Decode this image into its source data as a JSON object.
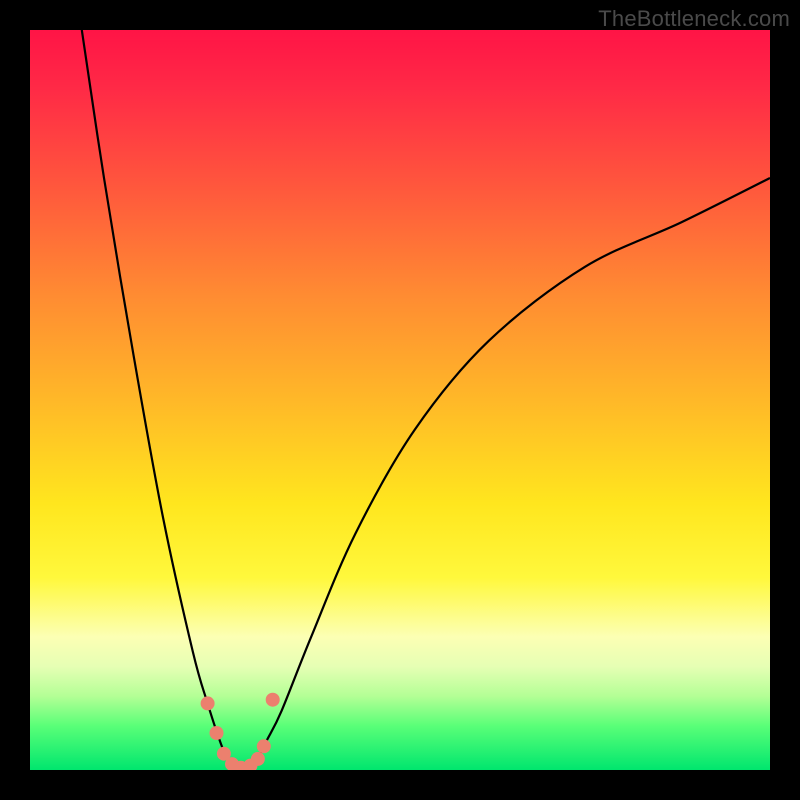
{
  "watermark": "TheBottleneck.com",
  "colors": {
    "frame": "#000000",
    "curve": "#000000",
    "marker": "#ec806e",
    "gradient_top": "#ff1446",
    "gradient_bottom": "#00e66e"
  },
  "chart_data": {
    "type": "line",
    "title": "",
    "xlabel": "",
    "ylabel": "",
    "xlim": [
      0,
      100
    ],
    "ylim": [
      0,
      100
    ],
    "note": "V-shaped bottleneck curve over a vertical red→green gradient. Both axes run 0–100 with no visible ticks. Lower y = better (green); higher y = worse (red). Minimum near x≈28 at y≈0; curve rises steeply to y≈100 at x≈7 on the left and more gradually toward y≈80 at x=100 on the right.",
    "series": [
      {
        "name": "bottleneck-curve",
        "x": [
          7,
          10,
          14,
          18,
          22,
          24,
          26,
          27,
          28,
          29,
          30,
          31,
          32,
          34,
          38,
          44,
          52,
          62,
          75,
          88,
          100
        ],
        "y": [
          100,
          80,
          56,
          34,
          16,
          9,
          3,
          1,
          0,
          0,
          1,
          2,
          4,
          8,
          18,
          32,
          46,
          58,
          68,
          74,
          80
        ]
      }
    ],
    "markers": {
      "name": "trough-markers",
      "x": [
        24.0,
        25.2,
        26.2,
        27.3,
        28.5,
        29.8,
        30.8,
        31.6,
        32.8
      ],
      "y": [
        9.0,
        5.0,
        2.2,
        0.8,
        0.3,
        0.6,
        1.5,
        3.2,
        9.5
      ]
    }
  }
}
